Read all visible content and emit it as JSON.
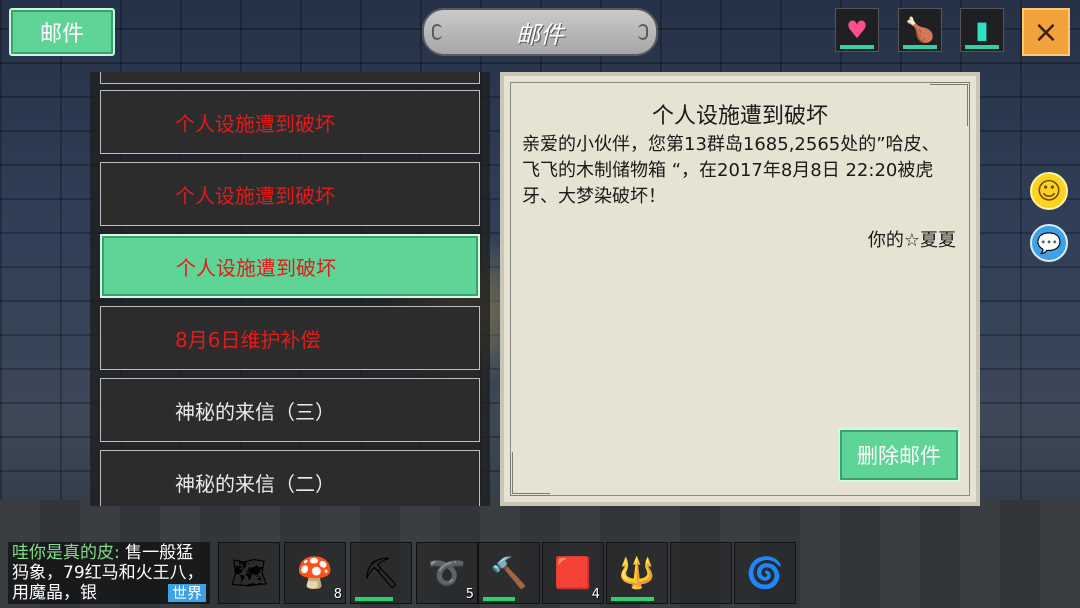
{
  "header": {
    "mail_button": "邮件",
    "title": "邮件",
    "close_icon": "×",
    "status": [
      {
        "name": "heart-icon",
        "glyph": "♥"
      },
      {
        "name": "food-icon",
        "glyph": "🍗"
      },
      {
        "name": "water-icon",
        "glyph": "▮"
      }
    ]
  },
  "mail_list": {
    "items": [
      {
        "label": "个人设施遭到破坏",
        "color": "#e21b1b",
        "selected": false
      },
      {
        "label": "个人设施遭到破坏",
        "color": "#e21b1b",
        "selected": false
      },
      {
        "label": "个人设施遭到破坏",
        "color": "#e21b1b",
        "selected": true
      },
      {
        "label": "8月6日维护补偿",
        "color": "#e21b1b",
        "selected": false
      },
      {
        "label": "神秘的来信（三）",
        "color": "#eaeaea",
        "selected": false
      },
      {
        "label": "神秘的来信（二）",
        "color": "#eaeaea",
        "selected": false
      }
    ]
  },
  "mail_detail": {
    "title": "个人设施遭到破坏",
    "body": "亲爱的小伙伴，您第13群岛1685,2565处的”哈皮、飞飞的木制储物箱 “，在2017年8月8日 22:20被虎牙、大梦染破坏！",
    "signature": "你的☆夏夏",
    "delete_button": "删除邮件"
  },
  "side_buttons": {
    "emoji_icon": "☺",
    "chat_icon": "💬"
  },
  "chat": {
    "speaker": "哇你是真的皮:",
    "message": " 售一般猛犸象，79红马和火王八，用魔晶，银",
    "channel": "世界"
  },
  "hotbar": [
    {
      "name": "slot-map",
      "glyph": "🗺",
      "count": "",
      "durability": 0
    },
    {
      "name": "slot-mushroom",
      "glyph": "🍄",
      "count": "8",
      "durability": 0
    },
    {
      "name": "slot-pickaxe",
      "glyph": "⛏",
      "count": "",
      "durability": 0.7
    },
    {
      "name": "slot-rope",
      "glyph": "➰",
      "count": "5",
      "durability": 0
    },
    {
      "name": "slot-hammer",
      "glyph": "🔨",
      "count": "",
      "durability": 0.6
    },
    {
      "name": "slot-leather",
      "glyph": "🟥",
      "count": "4",
      "durability": 0
    },
    {
      "name": "slot-staff",
      "glyph": "🔱",
      "count": "",
      "durability": 0.8
    },
    {
      "name": "slot-empty",
      "glyph": "",
      "count": "",
      "durability": 0
    },
    {
      "name": "slot-orb",
      "glyph": "🌀",
      "count": "",
      "durability": 0
    }
  ]
}
